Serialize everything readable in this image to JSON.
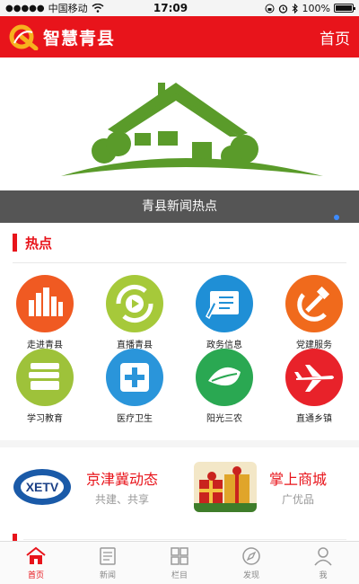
{
  "status_bar": {
    "signal_dots": "●●●●●",
    "carrier": "中国移动",
    "time": "17:09",
    "battery": "100%"
  },
  "header": {
    "title": "智慧青县",
    "home_link": "首页"
  },
  "banner": {
    "caption": "青县新闻热点"
  },
  "section": {
    "title": "热点"
  },
  "grid": [
    {
      "label": "走进青县",
      "icon": "city-buildings-icon",
      "color": "#f05a22"
    },
    {
      "label": "直播青县",
      "icon": "play-icon",
      "color": "#a6c93a"
    },
    {
      "label": "政务信息",
      "icon": "document-pen-icon",
      "color": "#1f8fd6"
    },
    {
      "label": "党建服务",
      "icon": "hammer-sickle-icon",
      "color": "#f06a1c"
    },
    {
      "label": "学习教育",
      "icon": "books-icon",
      "color": "#9ec23a"
    },
    {
      "label": "医疗卫生",
      "icon": "medical-cross-icon",
      "color": "#2a95da"
    },
    {
      "label": "阳光三农",
      "icon": "leaf-icon",
      "color": "#2aa852"
    },
    {
      "label": "直通乡镇",
      "icon": "airplane-icon",
      "color": "#e8222a"
    }
  ],
  "features": [
    {
      "title": "京津冀动态",
      "subtitle": "共建、共享",
      "image_text": "XETV"
    },
    {
      "title": "掌上商城",
      "subtitle": "广优品"
    }
  ],
  "tabs": [
    {
      "label": "首页",
      "icon": "home-icon",
      "active": true
    },
    {
      "label": "新闻",
      "icon": "news-icon",
      "active": false
    },
    {
      "label": "栏目",
      "icon": "grid-icon",
      "active": false
    },
    {
      "label": "发现",
      "icon": "compass-icon",
      "active": false
    },
    {
      "label": "我",
      "icon": "person-icon",
      "active": false
    }
  ],
  "colors": {
    "brand_red": "#e8141b",
    "house_green": "#5a9b2a"
  }
}
